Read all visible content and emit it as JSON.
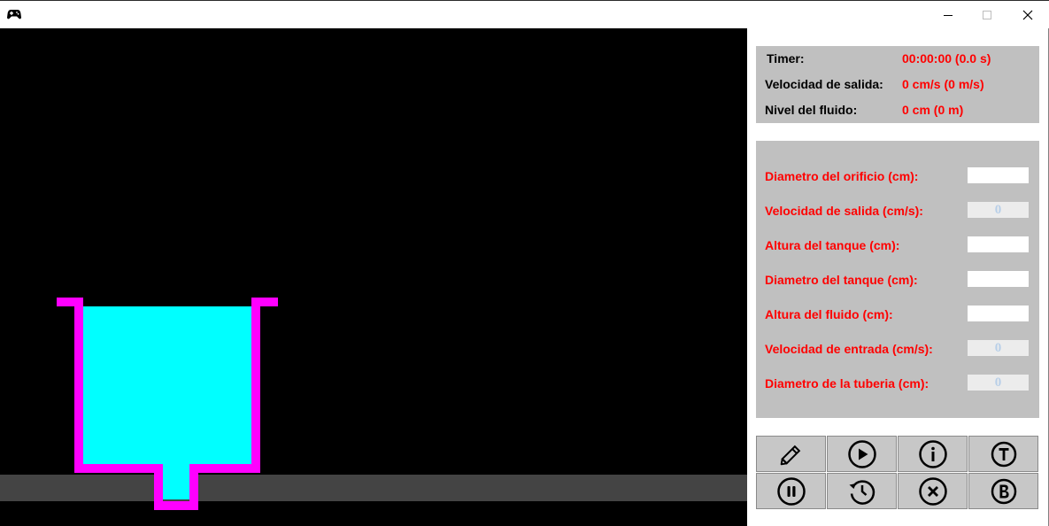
{
  "window": {
    "minimize_glyph": "—",
    "maximize_glyph": "☐",
    "close_glyph": "✕"
  },
  "colors": {
    "canvas_bg": "#000000",
    "floor": "#444444",
    "tank_wall": "#ff00ff",
    "fluid": "#00ffff",
    "panel_box": "#c0c0c0",
    "value_red": "#ff0000",
    "disabled_text": "#b8cfe8"
  },
  "status": {
    "timer_label": "Timer:",
    "timer_value": "00:00:00 (0.0 s)",
    "speed_label": "Velocidad de salida:",
    "speed_value": "0 cm/s (0 m/s)",
    "level_label": "Nivel del fluido:",
    "level_value": "0 cm (0 m)"
  },
  "params": [
    {
      "label": "Diametro del orificio (cm):",
      "value": "",
      "enabled": true
    },
    {
      "label": "Velocidad de salida (cm/s):",
      "value": "0",
      "enabled": false
    },
    {
      "label": "Altura del tanque (cm):",
      "value": "",
      "enabled": true
    },
    {
      "label": "Diametro del tanque (cm):",
      "value": "",
      "enabled": true
    },
    {
      "label": "Altura del fluido (cm):",
      "value": "",
      "enabled": true
    },
    {
      "label": "Velocidad de entrada (cm/s):",
      "value": "0",
      "enabled": false
    },
    {
      "label": "Diametro de la tuberia (cm):",
      "value": "0",
      "enabled": false
    }
  ],
  "toolbar": [
    {
      "icon": "pencil-icon"
    },
    {
      "icon": "play-icon"
    },
    {
      "icon": "info-icon"
    },
    {
      "icon": "t-circle-icon"
    },
    {
      "icon": "pause-icon"
    },
    {
      "icon": "history-icon"
    },
    {
      "icon": "close-circle-icon"
    },
    {
      "icon": "b-circle-icon"
    }
  ]
}
